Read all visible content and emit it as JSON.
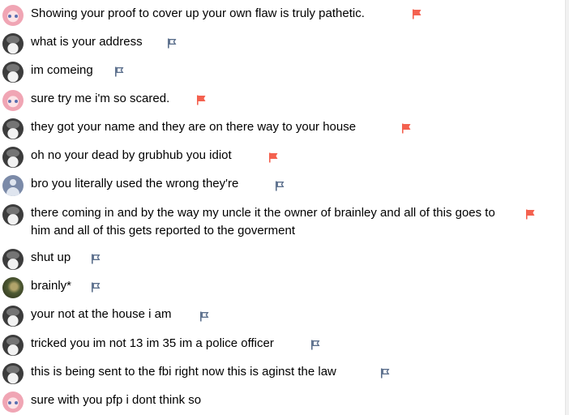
{
  "colors": {
    "flag_reported": "#f4614f",
    "flag_default": "#5b6f8c"
  },
  "comments": [
    {
      "text": "Showing your proof to cover up your own flaw is truly pathetic.",
      "avatar": "anime-girl-avatar",
      "flag": "reported"
    },
    {
      "text": "what is your address",
      "avatar": "dark-avatar",
      "flag": "default"
    },
    {
      "text": "im comeing",
      "avatar": "dark-avatar",
      "flag": "default"
    },
    {
      "text": "sure try me i'm so scared.",
      "avatar": "anime-girl-avatar",
      "flag": "reported"
    },
    {
      "text": "they got your name and they are on there way to your house",
      "avatar": "dark-avatar",
      "flag": "reported"
    },
    {
      "text": "oh no your dead by grubhub you idiot",
      "avatar": "dark-avatar",
      "flag": "reported"
    },
    {
      "text": "bro you literally used the wrong they're",
      "avatar": "default-user-avatar",
      "flag": "default"
    },
    {
      "text": "there coming in and by the way my uncle it the owner of brainley and all of this goes to him and all of this gets reported to the goverment",
      "avatar": "dark-avatar",
      "flag": "reported"
    },
    {
      "text": "shut up",
      "avatar": "dark-avatar",
      "flag": "default"
    },
    {
      "text": "brainly*",
      "avatar": "photo-avatar",
      "flag": "default"
    },
    {
      "text": "your not at the house i am",
      "avatar": "dark-avatar",
      "flag": "default"
    },
    {
      "text": "tricked you im not 13 im 35 im a police officer",
      "avatar": "dark-avatar",
      "flag": "default"
    },
    {
      "text": "this is being sent to the fbi right now this is aginst the law",
      "avatar": "dark-avatar",
      "flag": "default"
    },
    {
      "text": "sure with you pfp i dont think so",
      "avatar": "anime-girl-avatar",
      "flag": "none"
    }
  ]
}
